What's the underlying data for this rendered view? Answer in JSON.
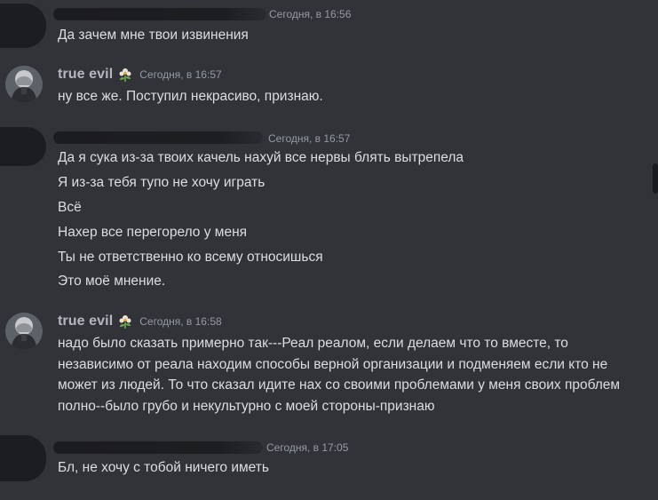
{
  "messages": [
    {
      "author": "",
      "author_hidden": true,
      "timestamp": "Сегодня, в 16:56",
      "lines": [
        "Да зачем мне твои извинения"
      ]
    },
    {
      "author": "true evil",
      "author_hidden": false,
      "badge_icon": "flower-badge-icon",
      "timestamp": "Сегодня, в 16:57",
      "lines": [
        "ну все же. Поступил некрасиво, признаю."
      ]
    },
    {
      "author": "",
      "author_hidden": true,
      "timestamp": "Сегодня, в 16:57",
      "lines": [
        "Да я сука из-за твоих качель нахуй все нервы блять вытрепела",
        "Я из-за тебя тупо не хочу играть",
        "Всё",
        "Нахер все перегорело у меня",
        "Ты не ответственно ко всему относишься",
        "Это моё мнение."
      ]
    },
    {
      "author": "true evil",
      "author_hidden": false,
      "badge_icon": "flower-badge-icon",
      "timestamp": "Сегодня, в 16:58",
      "lines": [
        "надо было сказать примерно так---Реал реалом, если делаем что то вместе, то независимо от реала находим способы верной организации и подменяем если кто не может из людей.  То что сказал идите нах со своими проблемами у меня своих проблем полно--было грубо и некультурно с моей стороны-признаю"
      ]
    },
    {
      "author": "",
      "author_hidden": true,
      "timestamp": "Сегодня, в 17:05",
      "lines": [
        "Бл, не хочу с тобой ничего иметь"
      ]
    }
  ],
  "colors": {
    "background": "#313338",
    "text": "#dbdee1",
    "username": "#b4b7bd",
    "timestamp": "#949ba4",
    "redaction": "#1c1d20"
  }
}
